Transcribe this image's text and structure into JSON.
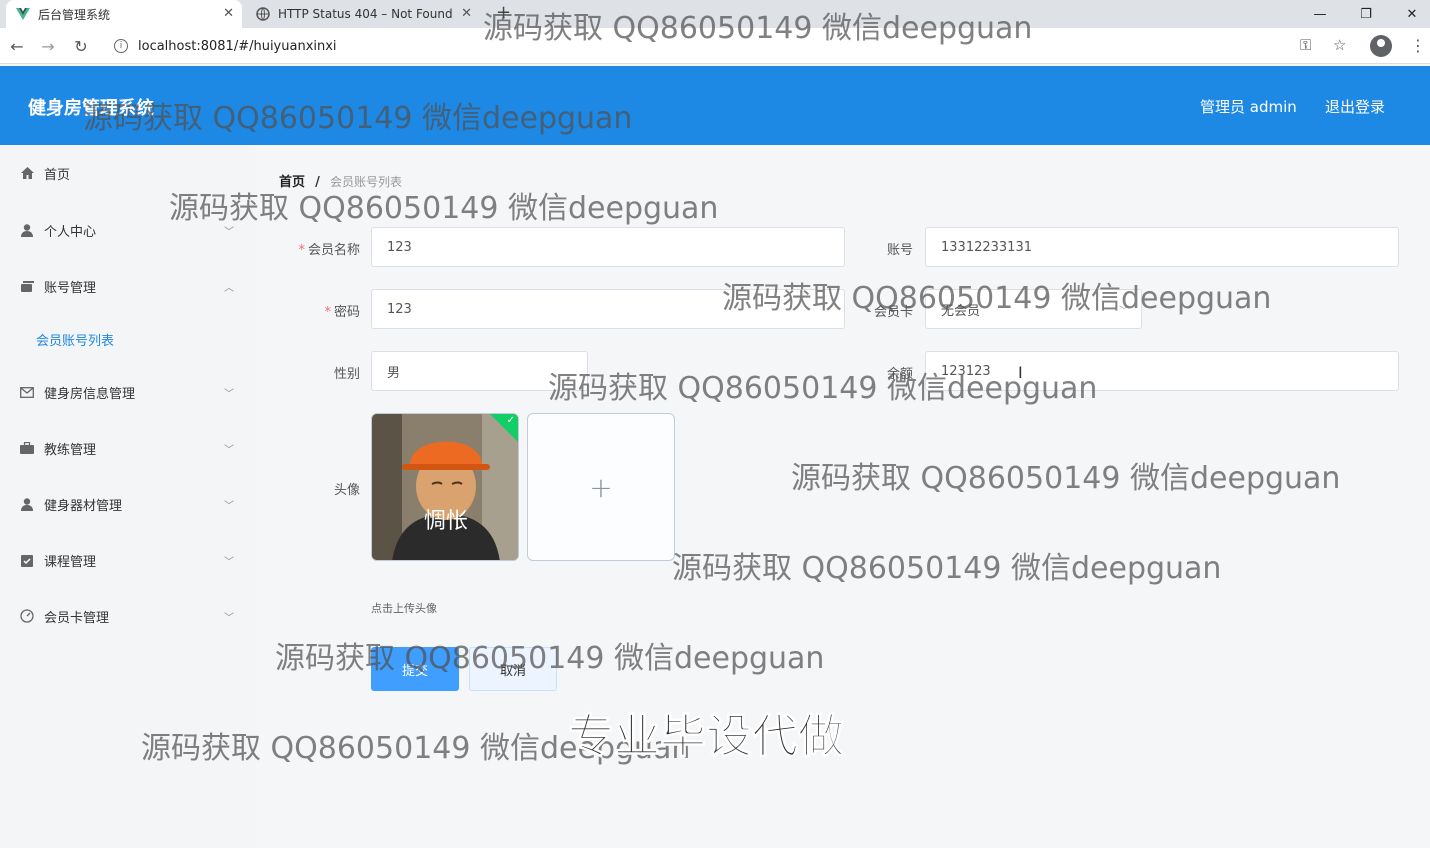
{
  "browser": {
    "tabs": [
      {
        "title": "后台管理系统",
        "active": true
      },
      {
        "title": "HTTP Status 404 – Not Found",
        "active": false
      }
    ],
    "url": "localhost:8081/#/huiyuanxinxi"
  },
  "header": {
    "brand": "健身房管理系统",
    "user": "管理员 admin",
    "logout": "退出登录"
  },
  "sidebar": {
    "items": [
      {
        "label": "首页",
        "icon": "home-icon"
      },
      {
        "label": "个人中心",
        "icon": "user-icon"
      },
      {
        "label": "账号管理",
        "icon": "account-icon"
      },
      {
        "label": "健身房信息管理",
        "icon": "mail-icon"
      },
      {
        "label": "教练管理",
        "icon": "briefcase-icon"
      },
      {
        "label": "健身器材管理",
        "icon": "user-icon"
      },
      {
        "label": "课程管理",
        "icon": "checklist-icon"
      },
      {
        "label": "会员卡管理",
        "icon": "gauge-icon"
      }
    ],
    "sub_item": "会员账号列表"
  },
  "breadcrumb": {
    "home": "首页",
    "sep": "/",
    "current": "会员账号列表"
  },
  "form": {
    "name_label": "会员名称",
    "name_value": "123",
    "account_label": "账号",
    "account_value": "13312233131",
    "password_label": "密码",
    "password_value": "123",
    "card_label": "会员卡",
    "card_value": "无会员",
    "gender_label": "性别",
    "gender_value": "男",
    "balance_label": "余额",
    "balance_value": "123123",
    "avatar_label": "头像",
    "avatar_caption": "惆怅",
    "upload_plus": "+",
    "upload_tip": "点击上传头像",
    "submit": "提交",
    "cancel": "取消"
  },
  "watermarks": {
    "text": "源码获取 QQ86050149 微信deepguan",
    "big": "专业毕设代做"
  }
}
